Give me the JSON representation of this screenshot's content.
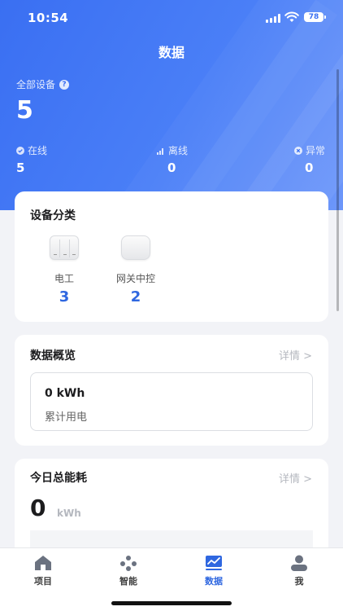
{
  "status_bar": {
    "time": "10:54",
    "battery": "78"
  },
  "page": {
    "title": "数据"
  },
  "summary": {
    "all_label": "全部设备",
    "all_count": "5",
    "online": {
      "label": "在线",
      "value": "5"
    },
    "offline": {
      "label": "离线",
      "value": "0"
    },
    "abnormal": {
      "label": "异常",
      "value": "0"
    }
  },
  "categories": {
    "title": "设备分类",
    "items": [
      {
        "name": "电工",
        "count": "3"
      },
      {
        "name": "网关中控",
        "count": "2"
      }
    ]
  },
  "overview": {
    "title": "数据概览",
    "detail": "详情 >",
    "value": "0 kWh",
    "label": "累计用电"
  },
  "today": {
    "title": "今日总能耗",
    "detail": "详情 >",
    "value": "0",
    "unit": "kWh"
  },
  "tabs": [
    {
      "label": "项目",
      "icon": "home-icon"
    },
    {
      "label": "智能",
      "icon": "smart-icon"
    },
    {
      "label": "数据",
      "icon": "chart-icon",
      "active": true
    },
    {
      "label": "我",
      "icon": "user-icon"
    }
  ],
  "colors": {
    "primary": "#3a6ff2",
    "accent_number": "#2f67e0",
    "background": "#f2f3f7"
  }
}
